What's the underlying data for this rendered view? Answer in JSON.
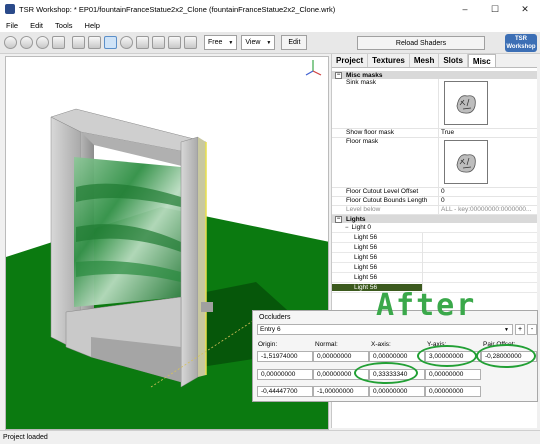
{
  "window": {
    "title": "TSR Workshop: * EP01/fountainFranceStatue2x2_Clone (fountainFranceStatue2x2_Clone.wrk)",
    "minimize": "–",
    "maximize": "☐",
    "close": "✕"
  },
  "menu": [
    "File",
    "Edit",
    "Tools",
    "Help"
  ],
  "toolbar": {
    "camera_mode": "Free",
    "view_label": "View",
    "edit_label": "Edit",
    "reload_label": "Reload Shaders",
    "logo_text": "TSR Workshop"
  },
  "tabs": [
    "Project",
    "Textures",
    "Mesh",
    "Slots",
    "Misc"
  ],
  "active_tab": "Misc",
  "properties": {
    "misc_masks_header": "Misc masks",
    "sink_mask": "Sink mask",
    "show_floor_mask": "Show floor mask",
    "show_floor_mask_value": "True",
    "floor_mask": "Floor mask",
    "floor_cutout_level_offset": "Floor Cutout Level Offset",
    "floor_cutout_level_offset_value": "0",
    "floor_cutout_bounds_length": "Floor Cutout Bounds Length",
    "floor_cutout_bounds_length_value": "0",
    "level_below": "Level below",
    "level_below_value": "ALL - key:00000000:0000000...",
    "lights_header": "Lights",
    "light_group": "Light 0",
    "lights": [
      "Light 56",
      "Light 56",
      "Light 56",
      "Light 56",
      "Light 56",
      "Light 56"
    ]
  },
  "occluders": {
    "title": "Occluders",
    "entry": "Entry 6",
    "columns": [
      "Origin:",
      "Normal:",
      "X-axis:",
      "Y-axis:",
      "Pair Offset:"
    ],
    "rows": [
      [
        "-1,51974000",
        "0,00000000",
        "0,00000000",
        "3,00000000",
        "-0,28000000"
      ],
      [
        "0,00000000",
        "0,00000000",
        "0,33333340",
        "0,00000000"
      ],
      [
        "-0,44447700",
        "-1,00000000",
        "0,00000000",
        "0,00000000"
      ]
    ],
    "add_btn": "+",
    "remove_btn": "-"
  },
  "annotation": "After",
  "status": "Project loaded",
  "colors": {
    "floor": "#0b7a10",
    "annotation": "#3aa84a",
    "selected_light": "#3c5a1e"
  }
}
